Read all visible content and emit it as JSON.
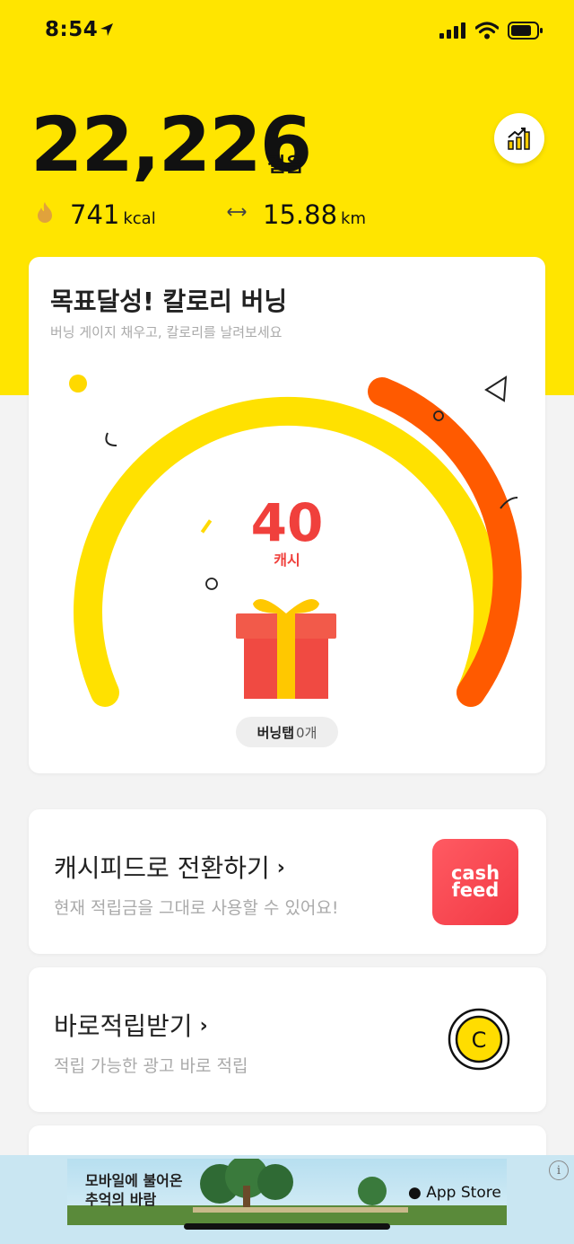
{
  "status": {
    "time": "8:54"
  },
  "summary": {
    "steps": "22,226",
    "steps_unit": "걸음",
    "calories": "741",
    "calories_unit": "kcal",
    "distance": "15.88",
    "distance_unit": "km"
  },
  "burning": {
    "title": "목표달성! 칼로리 버닝",
    "subtitle": "버닝 게이지 채우고, 칼로리를 날려보세요",
    "cash_value": "40",
    "cash_unit": "캐시",
    "tap_label": "버닝탭",
    "tap_count": "0개"
  },
  "cashfeed_card": {
    "title": "캐시피드로 전환하기",
    "subtitle": "현재 적립금을 그대로 사용할 수 있어요!",
    "logo_line1": "cash",
    "logo_line2": "feed"
  },
  "instant_card": {
    "title": "바로적립받기",
    "subtitle": "적립 가능한 광고 바로 적립",
    "coin_letter": "C"
  },
  "ad": {
    "text_line1": "모바일에 불어온",
    "text_line2": "추억의 바람",
    "store_label": "App Store",
    "info_label": "i"
  },
  "colors": {
    "brand_yellow": "#ffe500",
    "gauge_orange": "#ff5a00",
    "cash_red": "#f0403c"
  },
  "icons": [
    "location-arrow-icon",
    "signal-icon",
    "wifi-icon",
    "battery-icon",
    "chart-icon",
    "flame-icon",
    "distance-arrows-icon",
    "chevron-right-icon",
    "gift-icon",
    "coin-icon",
    "apple-icon",
    "info-icon"
  ]
}
